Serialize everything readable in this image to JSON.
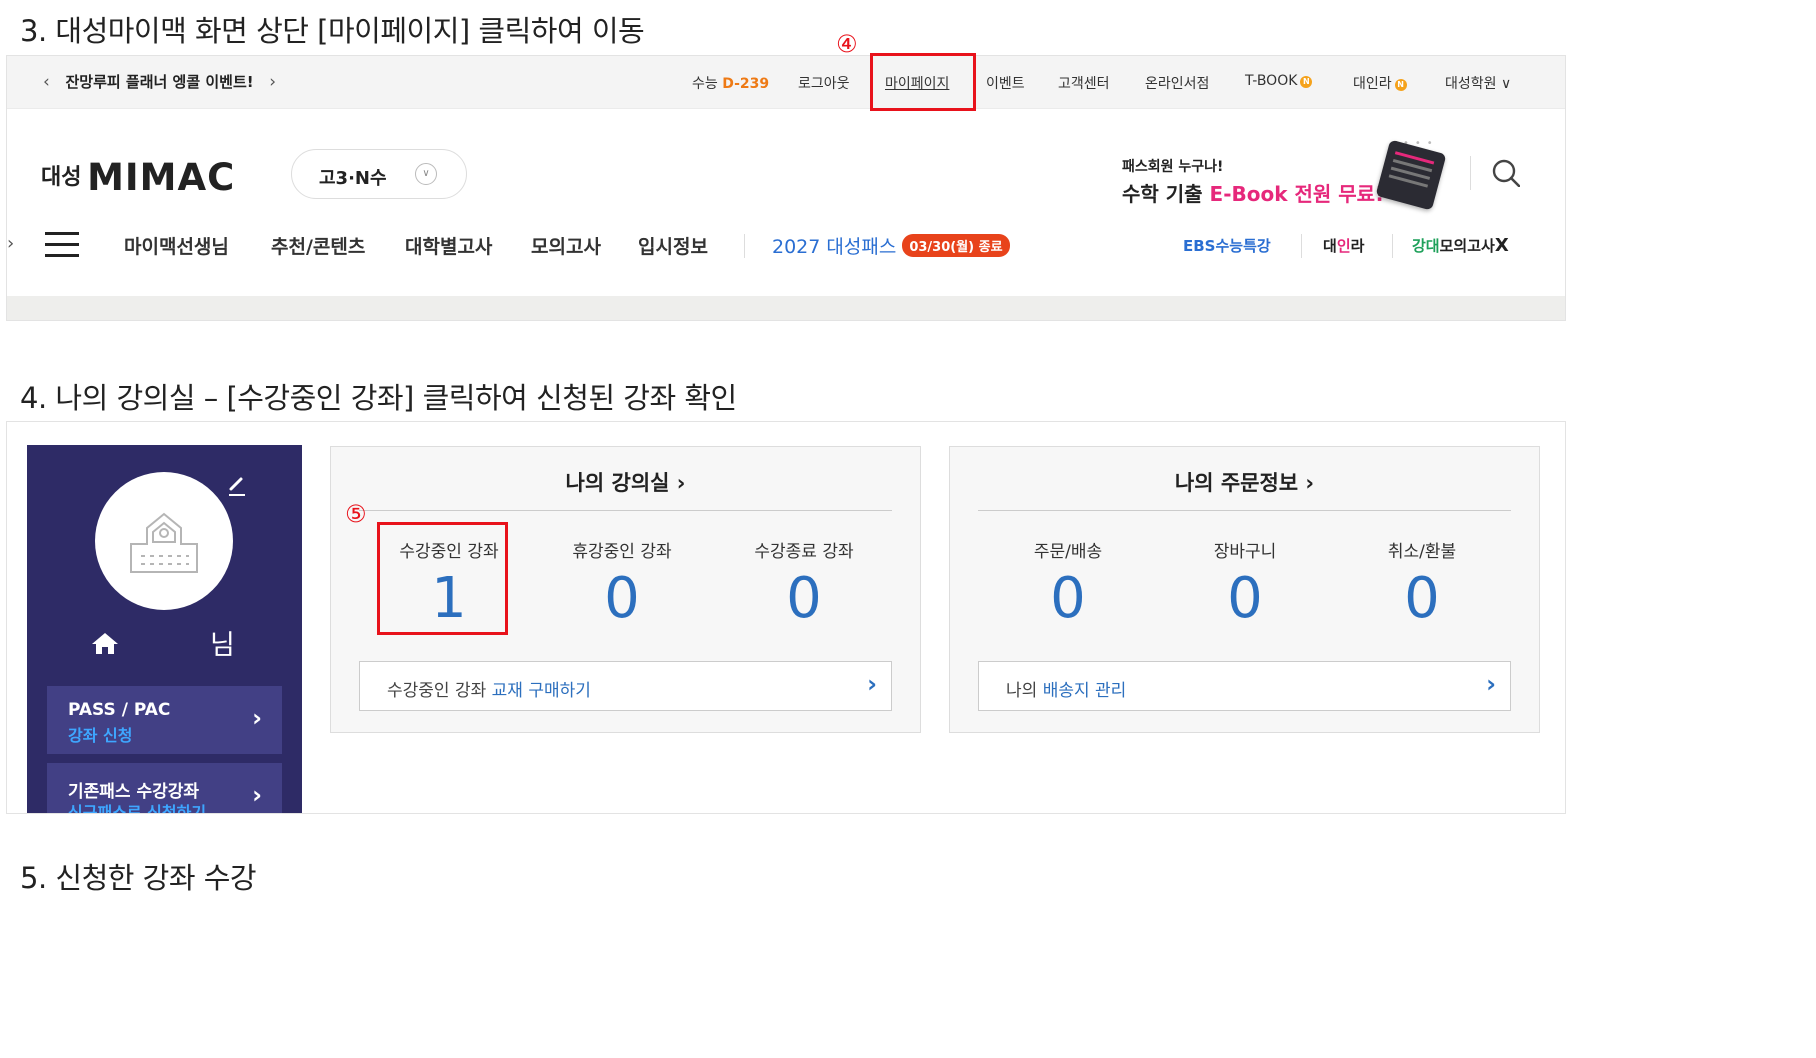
{
  "headings": {
    "step3": "3. 대성마이맥 화면 상단 [마이페이지] 클릭하여 이동",
    "step4": "4. 나의 강의실 – [수강중인 강좌] 클릭하여 신청된 강좌 확인",
    "step5": "5. 신청한 강좌 수강"
  },
  "markers": {
    "m4": "④",
    "m5": "⑤"
  },
  "topbar": {
    "promo_prev": "‹",
    "promo_text": "잔망루피 플래너 엥콜 이벤트!",
    "promo_next": "›",
    "suneung_label": "수능",
    "suneung_dday": "D-239",
    "logout": "로그아웃",
    "mypage": "마이페이지",
    "event": "이벤트",
    "customer": "고객센터",
    "bookstore": "온라인서점",
    "tbook": "T-BOOK",
    "dainra": "대인라",
    "new_badge": "N",
    "academy": "대성학원",
    "academy_chev": "∨"
  },
  "header": {
    "logo_ko": "대성",
    "logo_en": "MIMAC",
    "grade": "고3·N수",
    "grade_chev": "∨",
    "banner_line1": "패스회원 누구나!",
    "banner_line2_a": "수학 기출 ",
    "banner_line2_b": "E-Book",
    "banner_line2_c": " 전원 무료!",
    "carousel_dots": "•••"
  },
  "gnb": {
    "left_arrow": "›",
    "items": [
      "마이맥선생님",
      "추천/콘텐츠",
      "대학별고사",
      "모의고사",
      "입시정보"
    ],
    "pass": "2027 대성패스",
    "pass_badge": "03/30(월) 종료",
    "quick": {
      "ebs": "EBS수능특강",
      "dain_a": "대",
      "dain_b": "인",
      "dain_c": "라",
      "gangdae_a": "강대",
      "gangdae_b": "모의고사",
      "gangdae_c": "X"
    }
  },
  "profile": {
    "nim": "님",
    "menu1_line1": "PASS / PAC",
    "menu1_line2": "강좌 신청",
    "menu2_line1": "기존패스 수강강좌",
    "menu2_line2": "신규패스로 신청하기",
    "arrow": "›"
  },
  "classroom": {
    "title": "나의 강의실 ›",
    "stats": [
      {
        "label": "수강중인 강좌",
        "value": "1"
      },
      {
        "label": "휴강중인 강좌",
        "value": "0"
      },
      {
        "label": "수강종료 강좌",
        "value": "0"
      }
    ],
    "link_prefix": "수강중인 강좌 ",
    "link_blue": "교재 구매하기",
    "link_arrow": "›"
  },
  "orders": {
    "title": "나의 주문정보 ›",
    "stats": [
      {
        "label": "주문/배송",
        "value": "0"
      },
      {
        "label": "장바구니",
        "value": "0"
      },
      {
        "label": "취소/환불",
        "value": "0"
      }
    ],
    "link_prefix": "나의 ",
    "link_blue": "배송지 관리",
    "link_arrow": "›"
  },
  "colors": {
    "accent_red": "#e8121b",
    "navy": "#2e2b66",
    "stat_blue": "#2c6fbe",
    "dday_orange": "#ee7a15"
  }
}
